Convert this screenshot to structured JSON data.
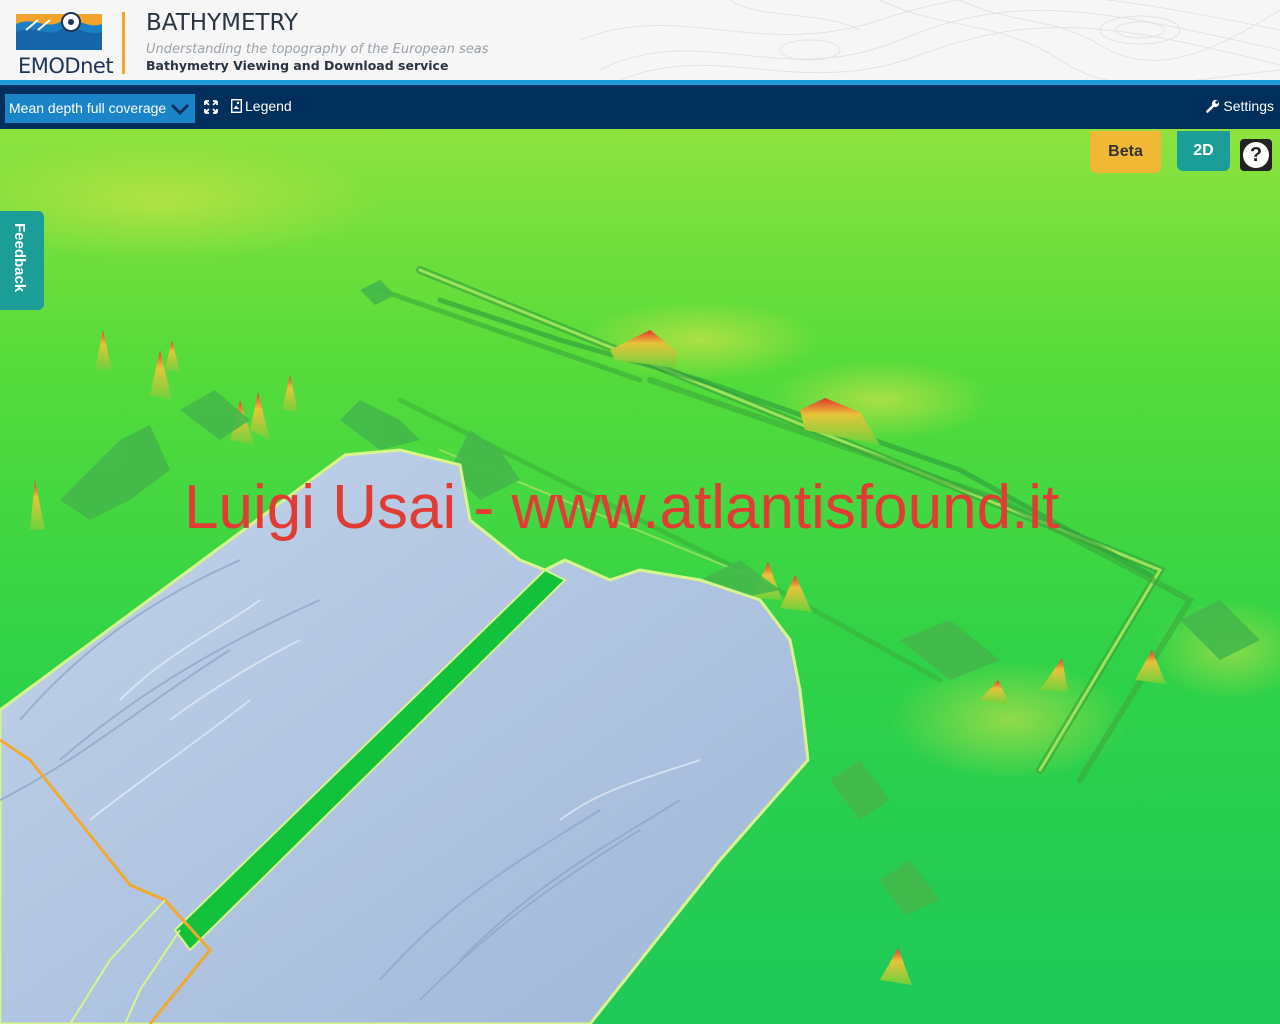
{
  "header": {
    "logo_text": "EMODnet",
    "title": "BATHYMETRY",
    "subtitle": "Understanding the topography of the European seas",
    "service": "Bathymetry Viewing and Download service"
  },
  "toolbar": {
    "layer_select_value": "Mean depth full coverage",
    "legend_label": "Legend",
    "settings_label": "Settings"
  },
  "map": {
    "beta_label": "Beta",
    "mode_label": "2D",
    "help_label": "?",
    "feedback_label": "Feedback",
    "watermark": "Luigi Usai - www.atlantisfound.it"
  },
  "colors": {
    "header_bg": "#f6f6f6",
    "toolbar_bg": "#002f5b",
    "accent_blue": "#1a9cd6",
    "beta_yellow": "#f0b834",
    "teal": "#1b9e97",
    "terrain_green": "#3fd64a",
    "survey_blue": "#b4c9e3",
    "watermark_red": "#e03c33"
  },
  "icons": [
    "fullscreen-icon",
    "legend-icon",
    "wrench-icon",
    "chevron-down-icon",
    "help-icon"
  ]
}
